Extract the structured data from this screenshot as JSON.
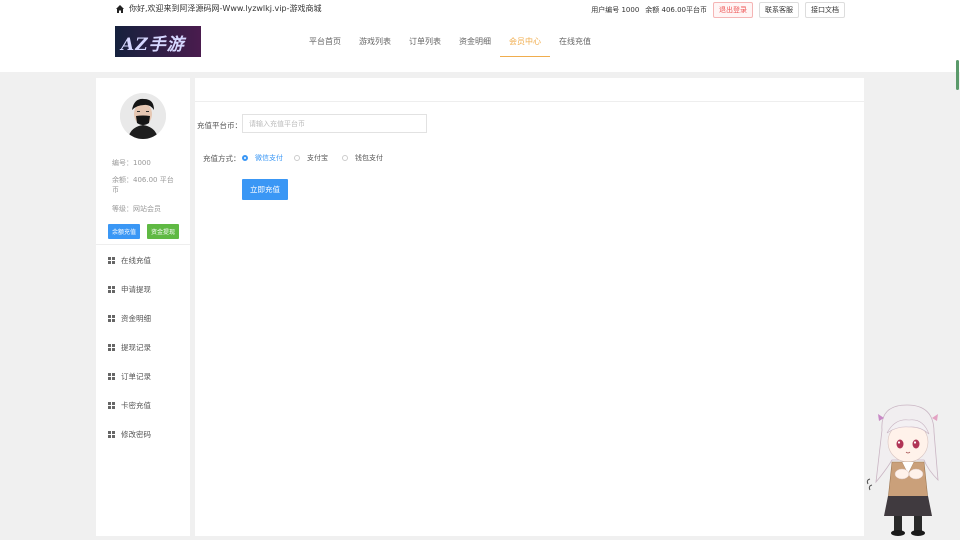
{
  "header": {
    "welcome": "你好,欢迎来到阿泽源码网-Www.lyzwlkj.vip-游戏商城",
    "user_id_text": "用户编号 1000",
    "balance_text": "余额 406.00平台币",
    "logout": "退出登录",
    "contact": "联系客服",
    "api_docs": "接口文档",
    "logo_text": "AZ手游"
  },
  "nav": {
    "items": [
      "平台首页",
      "游戏列表",
      "订单列表",
      "资金明细",
      "会员中心",
      "在线充值"
    ],
    "active_index": 4
  },
  "sidebar": {
    "id_text": "编号：1000",
    "balance_text": "余额：406.00 平台币",
    "level_text": "等级：网站会员",
    "btn_recharge": "余额充值",
    "btn_withdraw": "资金提现",
    "menu": [
      "在线充值",
      "申请提现",
      "资金明细",
      "提现记录",
      "订单记录",
      "卡密充值",
      "修改密码"
    ]
  },
  "form": {
    "amount_label": "充值平台币：",
    "amount_placeholder": "请输入充值平台币",
    "amount_value": "",
    "method_label": "充值方式：",
    "methods": [
      "微信支付",
      "支付宝",
      "钱包支付"
    ],
    "selected_method": "微信支付",
    "submit": "立即充值"
  },
  "colors": {
    "accent_blue": "#3a97f5",
    "accent_green": "#5fb943",
    "nav_active": "#f0ad4e",
    "logout_red": "#ee5555"
  }
}
